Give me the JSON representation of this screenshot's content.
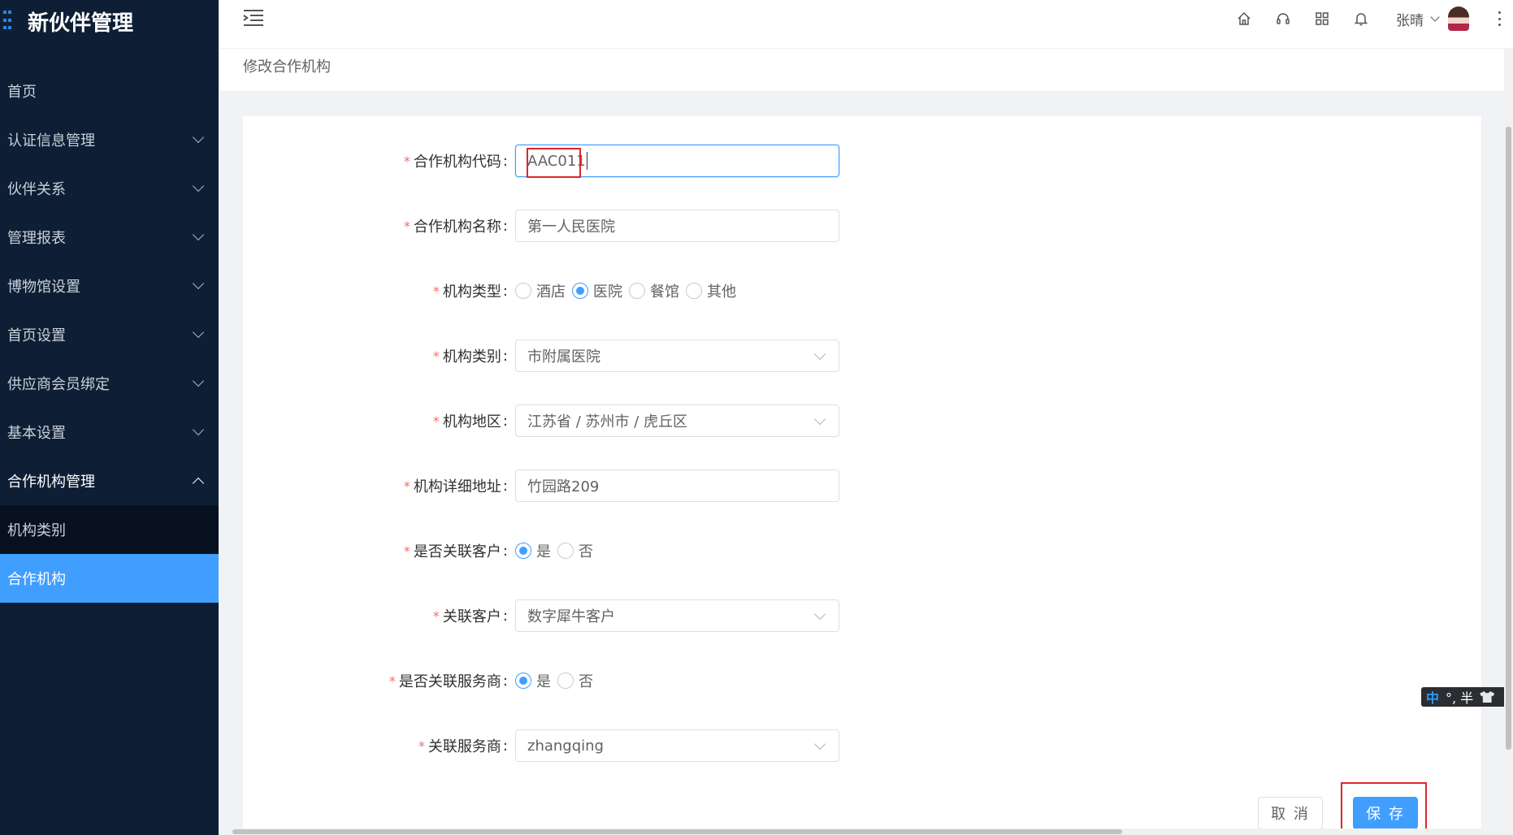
{
  "app": {
    "title": "新伙伴管理"
  },
  "sidebar": {
    "items": [
      {
        "label": "首页",
        "has_children": false
      },
      {
        "label": "认证信息管理",
        "has_children": true
      },
      {
        "label": "伙伴关系",
        "has_children": true
      },
      {
        "label": "管理报表",
        "has_children": true
      },
      {
        "label": "博物馆设置",
        "has_children": true
      },
      {
        "label": "首页设置",
        "has_children": true
      },
      {
        "label": "供应商会员绑定",
        "has_children": true
      },
      {
        "label": "基本设置",
        "has_children": true
      },
      {
        "label": "合作机构管理",
        "has_children": true,
        "expanded": true,
        "children": [
          {
            "label": "机构类别",
            "active": false
          },
          {
            "label": "合作机构",
            "active": true
          }
        ]
      }
    ],
    "active_color": "#409eff",
    "bg_color": "#0e1f35"
  },
  "header": {
    "icons": [
      "home-icon",
      "headset-icon",
      "grid-icon",
      "bell-icon"
    ],
    "user": {
      "name": "张晴"
    }
  },
  "breadcrumb": "修改合作机构",
  "form": {
    "code": {
      "label": "合作机构代码",
      "value": "AAC011",
      "required": true
    },
    "name": {
      "label": "合作机构名称",
      "value": "第一人民医院",
      "required": true
    },
    "type": {
      "label": "机构类型",
      "required": true,
      "options": [
        "酒店",
        "医院",
        "餐馆",
        "其他"
      ],
      "selected": "医院"
    },
    "category": {
      "label": "机构类别",
      "value": "市附属医院",
      "required": true
    },
    "region": {
      "label": "机构地区",
      "value": "江苏省 / 苏州市 / 虎丘区",
      "required": true
    },
    "address": {
      "label": "机构详细地址",
      "value": "竹园路209",
      "required": true
    },
    "link_customer": {
      "label": "是否关联客户",
      "required": true,
      "options": [
        "是",
        "否"
      ],
      "selected": "是"
    },
    "customer": {
      "label": "关联客户",
      "value": "数字犀牛客户",
      "required": true
    },
    "link_provider": {
      "label": "是否关联服务商",
      "required": true,
      "options": [
        "是",
        "否"
      ],
      "selected": "是"
    },
    "provider": {
      "label": "关联服务商",
      "value": "zhangqing",
      "required": true
    },
    "cancel_label": "取 消",
    "save_label": "保 存"
  },
  "ime": {
    "mode": "中",
    "punct": "°, 半"
  }
}
